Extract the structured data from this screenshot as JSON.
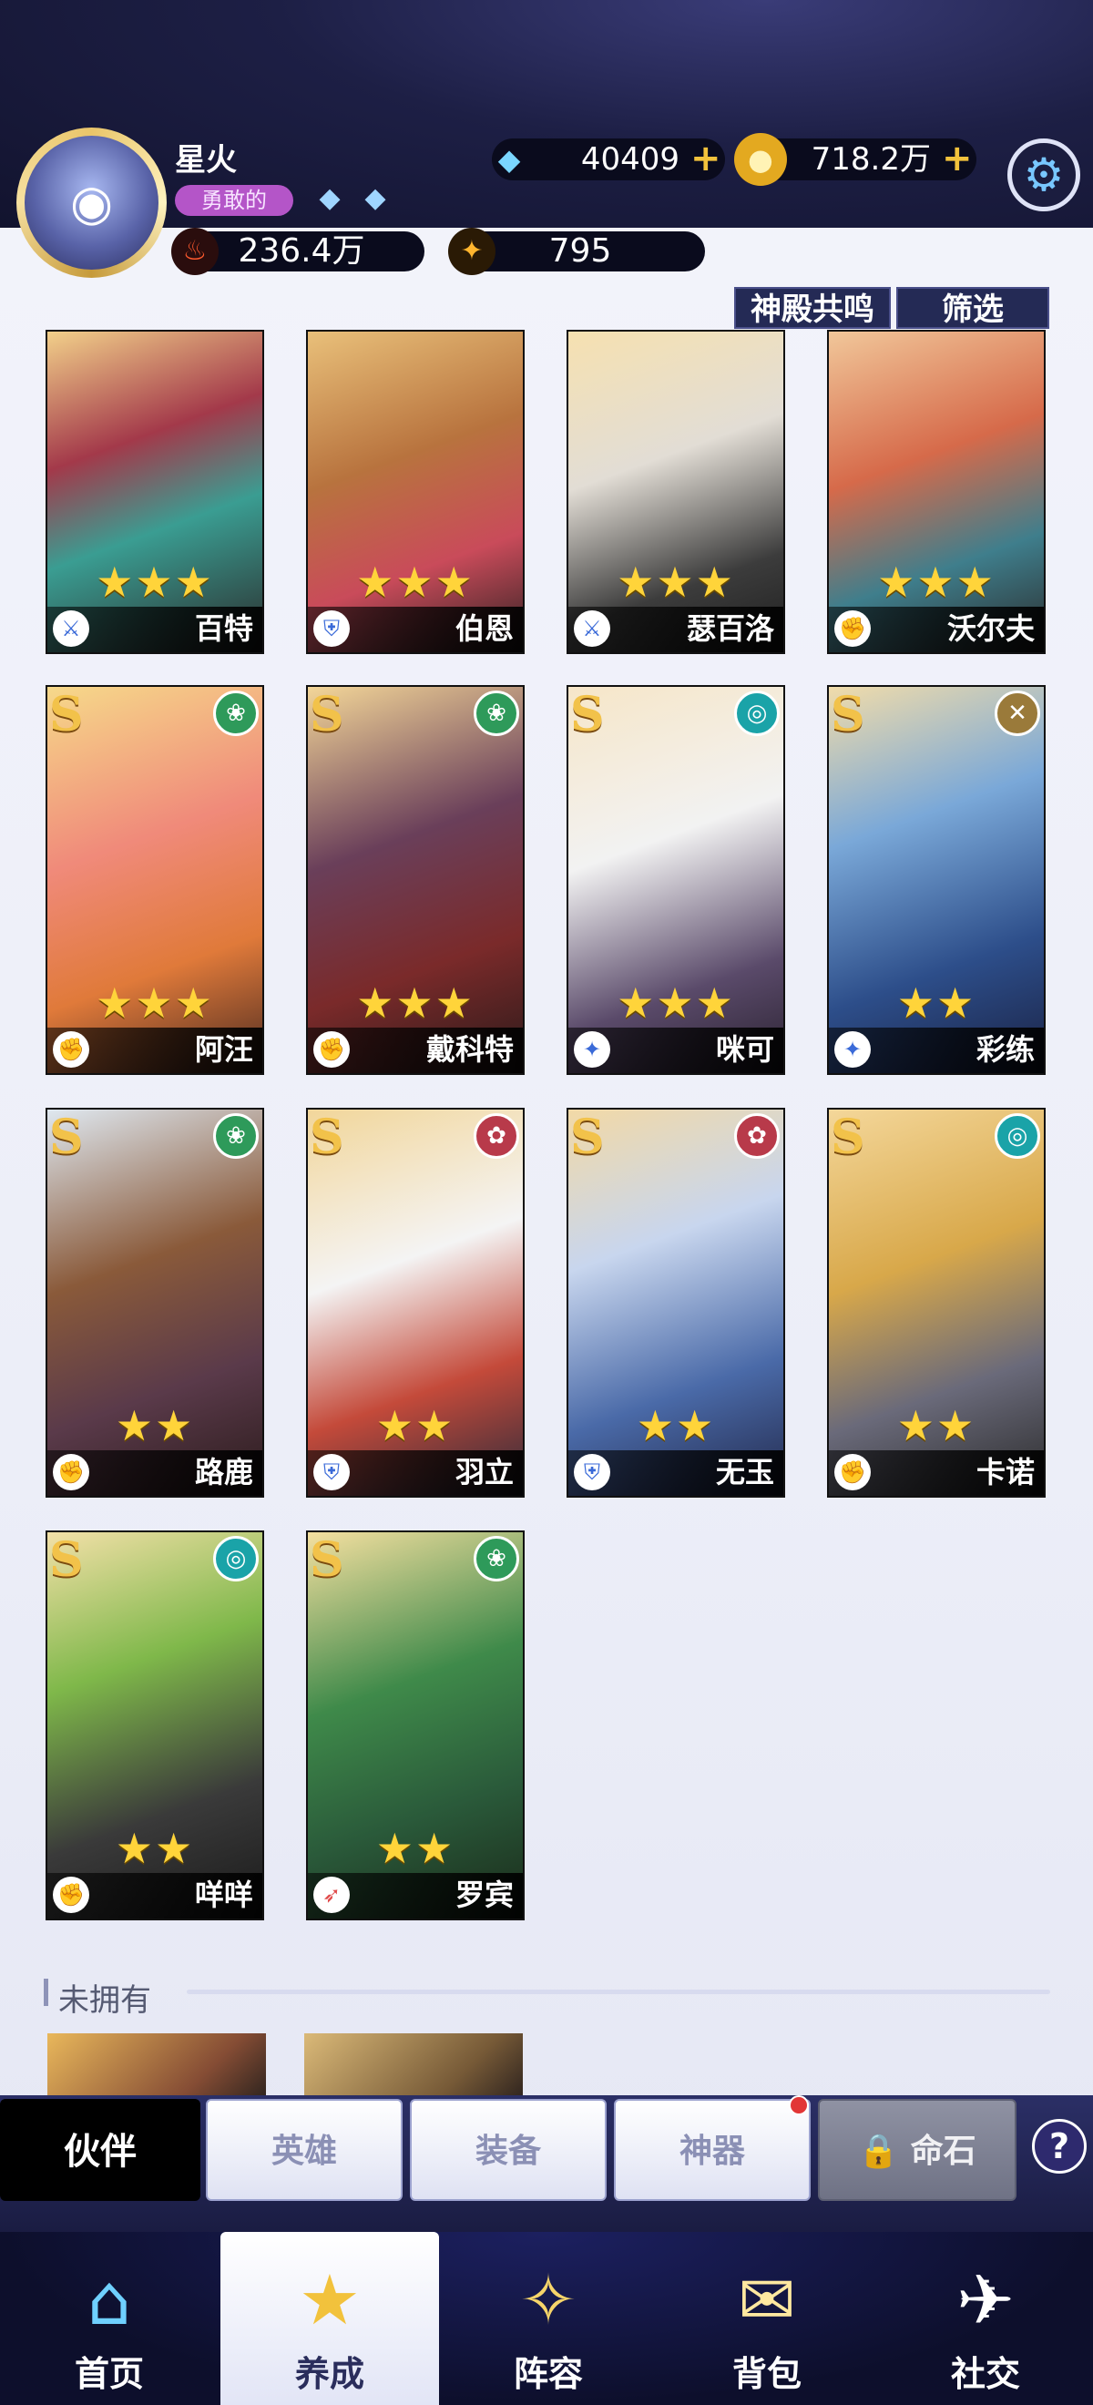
{
  "player": {
    "name": "星火",
    "title": "勇敢的",
    "power": "236.4万",
    "stars": "795"
  },
  "currency": {
    "diamonds": "40409",
    "coins": "718.2万"
  },
  "actions": {
    "resonance": "神殿共鸣",
    "filter": "筛选"
  },
  "owned": [
    {
      "name": "百特",
      "stars": "★★★",
      "rank": "",
      "element": "",
      "class": "sword"
    },
    {
      "name": "伯恩",
      "stars": "★★★",
      "rank": "",
      "element": "",
      "class": "shield"
    },
    {
      "name": "瑟百洛",
      "stars": "★★★",
      "rank": "",
      "element": "",
      "class": "sword"
    },
    {
      "name": "沃尔夫",
      "stars": "★★★",
      "rank": "",
      "element": "",
      "class": "fist"
    },
    {
      "name": "阿汪",
      "stars": "★★★",
      "rank": "S",
      "element": "forest",
      "class": "fist"
    },
    {
      "name": "戴科特",
      "stars": "★★★",
      "rank": "S",
      "element": "forest",
      "class": "fist"
    },
    {
      "name": "咪可",
      "stars": "★★★",
      "rank": "S",
      "element": "wind",
      "class": "magic"
    },
    {
      "name": "彩练",
      "stars": "★★",
      "rank": "S",
      "element": "light",
      "class": "magic"
    },
    {
      "name": "路鹿",
      "stars": "★★",
      "rank": "S",
      "element": "forest",
      "class": "fist"
    },
    {
      "name": "羽立",
      "stars": "★★",
      "rank": "S",
      "element": "fire",
      "class": "shield"
    },
    {
      "name": "无玉",
      "stars": "★★",
      "rank": "S",
      "element": "fire",
      "class": "shield"
    },
    {
      "name": "卡诺",
      "stars": "★★",
      "rank": "S",
      "element": "wind",
      "class": "fist"
    },
    {
      "name": "咩咩",
      "stars": "★★",
      "rank": "S",
      "element": "wind",
      "class": "fist"
    },
    {
      "name": "罗宾",
      "stars": "★★",
      "rank": "S",
      "element": "forest",
      "class": "bow"
    }
  ],
  "not_owned": {
    "title": "未拥有"
  },
  "subtabs": [
    "伙伴",
    "英雄",
    "装备",
    "神器",
    "命石"
  ],
  "nav": [
    "首页",
    "养成",
    "阵容",
    "背包",
    "社交"
  ]
}
